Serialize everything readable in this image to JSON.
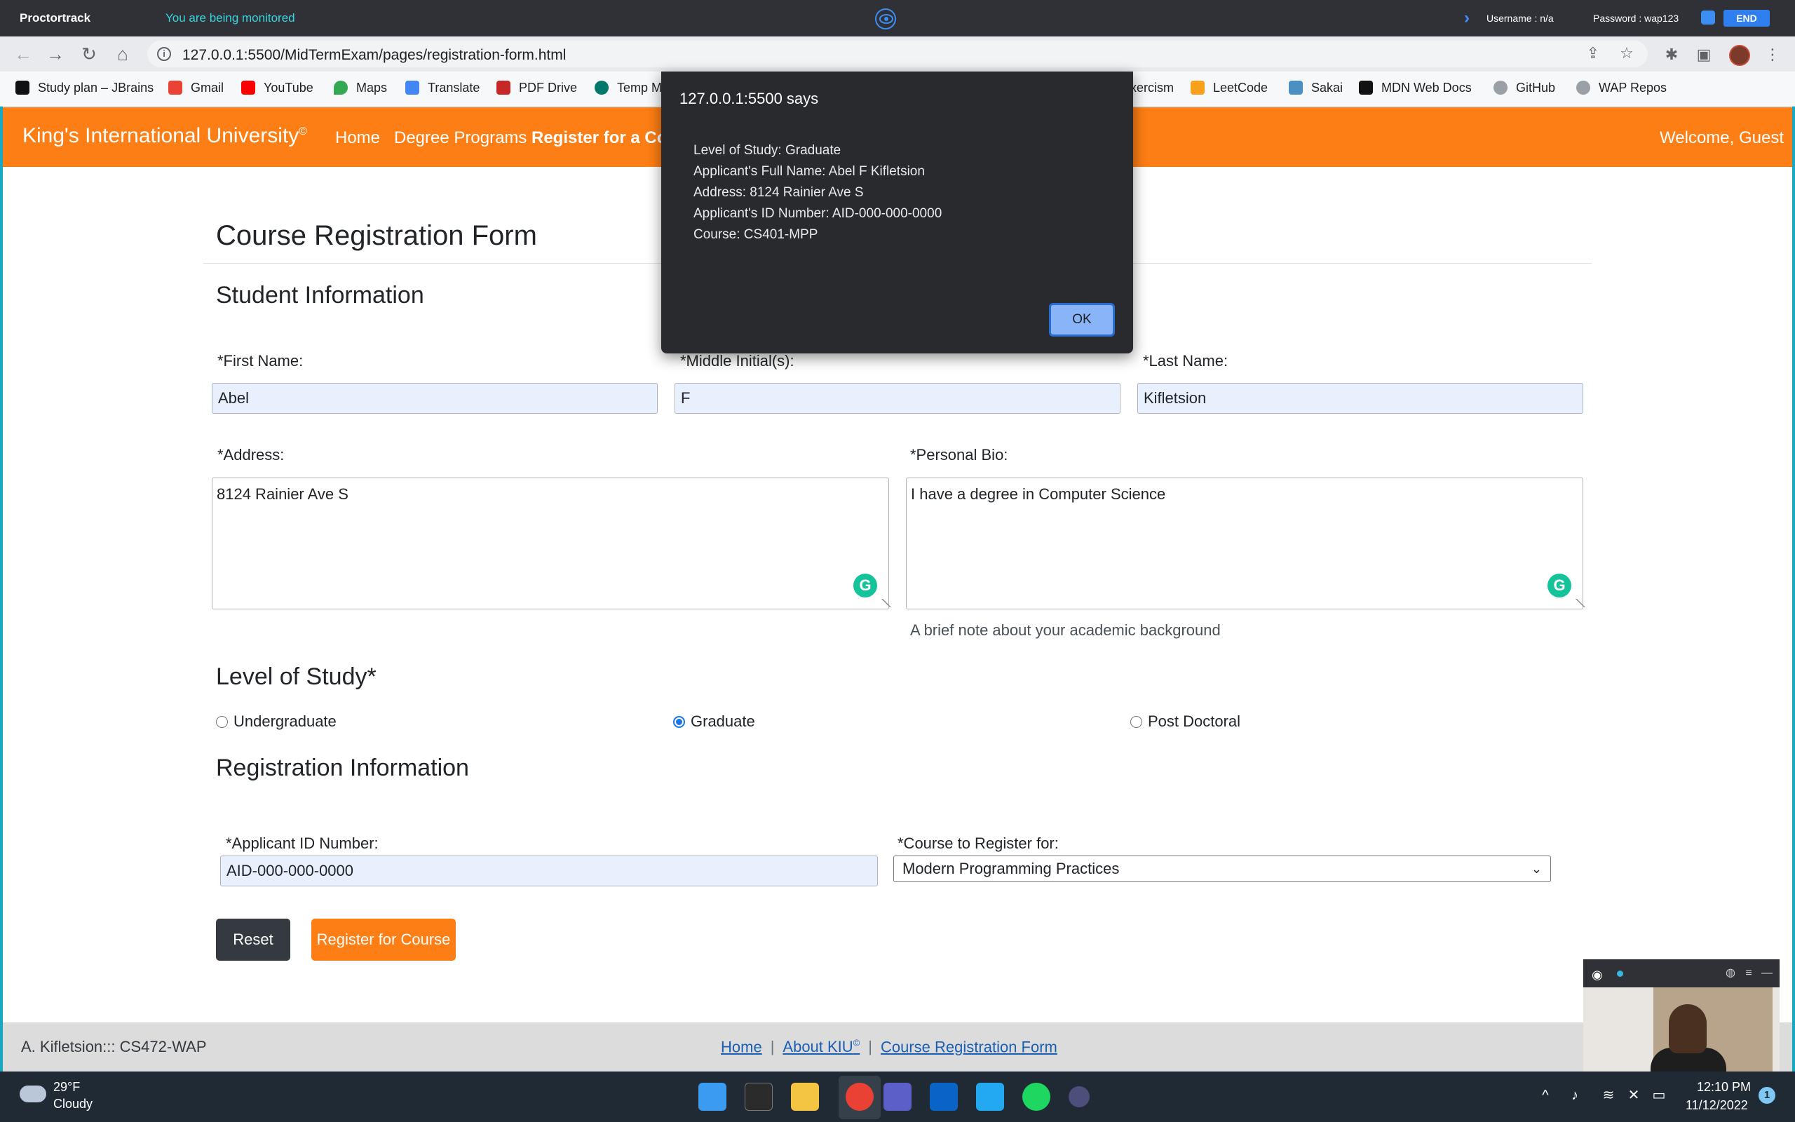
{
  "proctor": {
    "brand": "Proctortrack",
    "status": "You are being monitored",
    "username": "Username : n/a",
    "password": "Password : wap123",
    "end_label": "END"
  },
  "browser": {
    "url": "127.0.0.1:5500/MidTermExam/pages/registration-form.html",
    "bookmarks": [
      {
        "label": "Study plan – JBrains",
        "color": "#111111"
      },
      {
        "label": "Gmail",
        "color": "#ea4335"
      },
      {
        "label": "YouTube",
        "color": "#ff0000"
      },
      {
        "label": "Maps",
        "color": "#34a853"
      },
      {
        "label": "Translate",
        "color": "#4285f4"
      },
      {
        "label": "PDF Drive",
        "color": "#c62828"
      },
      {
        "label": "Temp M",
        "color": "#00796b"
      },
      {
        "label": "xercism",
        "color": "#604fcd"
      },
      {
        "label": "LeetCode",
        "color": "#f89f1b"
      },
      {
        "label": "Sakai",
        "color": "#4a90c2"
      },
      {
        "label": "MDN Web Docs",
        "color": "#111111"
      },
      {
        "label": "GitHub",
        "color": "#9aa0a6"
      },
      {
        "label": "WAP Repos",
        "color": "#9aa0a6"
      }
    ]
  },
  "site": {
    "brand": "King's International University",
    "brand_mark": "©",
    "nav": [
      "Home",
      "Degree Programs",
      "Register for a Cou"
    ],
    "welcome": "Welcome, Guest"
  },
  "form": {
    "title": "Course Registration Form",
    "student_heading": "Student Information",
    "first_name_label": "*First Name:",
    "first_name_value": "Abel",
    "middle_label": "*Middle Initial(s):",
    "middle_value": "F",
    "last_name_label": "*Last Name:",
    "last_name_value": "Kifletsion",
    "address_label": "*Address:",
    "address_value": "8124 Rainier Ave S",
    "bio_label": "*Personal Bio:",
    "bio_value": "I have a degree in Computer Science",
    "bio_help": "A brief note about your academic background",
    "level_heading": "Level of Study*",
    "levels": [
      "Undergraduate",
      "Graduate",
      "Post Doctoral"
    ],
    "selected_level": "Graduate",
    "registration_heading": "Registration Information",
    "applicant_id_label": "*Applicant ID Number:",
    "applicant_id_value": "AID-000-000-0000",
    "course_label": "*Course to Register for:",
    "course_value": "Modern Programming Practices",
    "reset_label": "Reset",
    "submit_label": "Register for Course"
  },
  "footer": {
    "left": "A. Kifletsion::: CS472-WAP",
    "links": [
      "Home",
      "About KIU",
      "Course Registration Form"
    ],
    "about_mark": "©",
    "separator": "|"
  },
  "dialog": {
    "title": "127.0.0.1:5500 says",
    "lines": [
      "Level of Study: Graduate",
      "Applicant's Full Name: Abel F Kifletsion",
      "Address: 8124 Rainier Ave S",
      "Applicant's ID Number: AID-000-000-0000",
      "Course: CS401-MPP"
    ],
    "ok_label": "OK"
  },
  "taskbar": {
    "temperature": "29°F",
    "condition": "Cloudy",
    "time": "12:10 PM",
    "date": "11/12/2022",
    "notifications": "1"
  },
  "colors": {
    "brand_orange": "#fd7e14",
    "dark_button": "#343a40",
    "dialog_bg": "#292a2d",
    "ok_button": "#8ab4f8",
    "proctor_bar": "#2f3136",
    "taskbar": "#1f2a35"
  }
}
